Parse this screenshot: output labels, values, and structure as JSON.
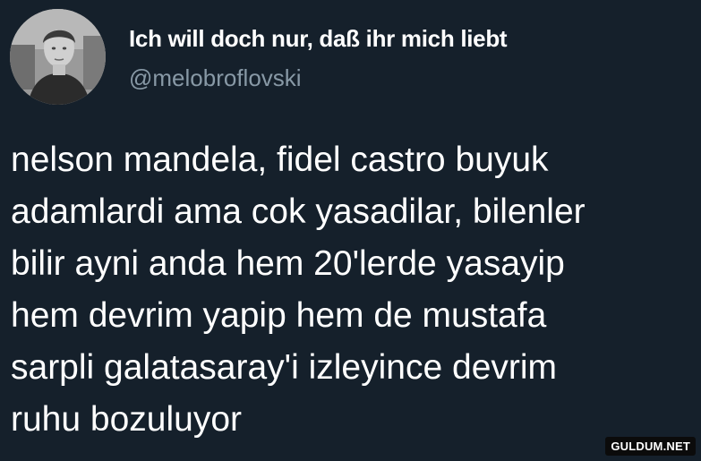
{
  "tweet": {
    "display_name": "Ich will doch nur, daß ihr mich liebt",
    "handle": "@melobroflovski",
    "text": "nelson mandela, fidel castro buyuk\nadamlardi ama cok yasadilar, bilenler\nbilir ayni anda hem 20'lerde yasayip\nhem devrim yapip hem de mustafa\nsarpli galatasaray'i izleyince devrim\nruhu bozuluyor"
  },
  "watermark": {
    "text": "GULDUM.NET"
  },
  "colors": {
    "background": "#15202b",
    "text": "#ffffff",
    "handle": "#8899a6"
  }
}
